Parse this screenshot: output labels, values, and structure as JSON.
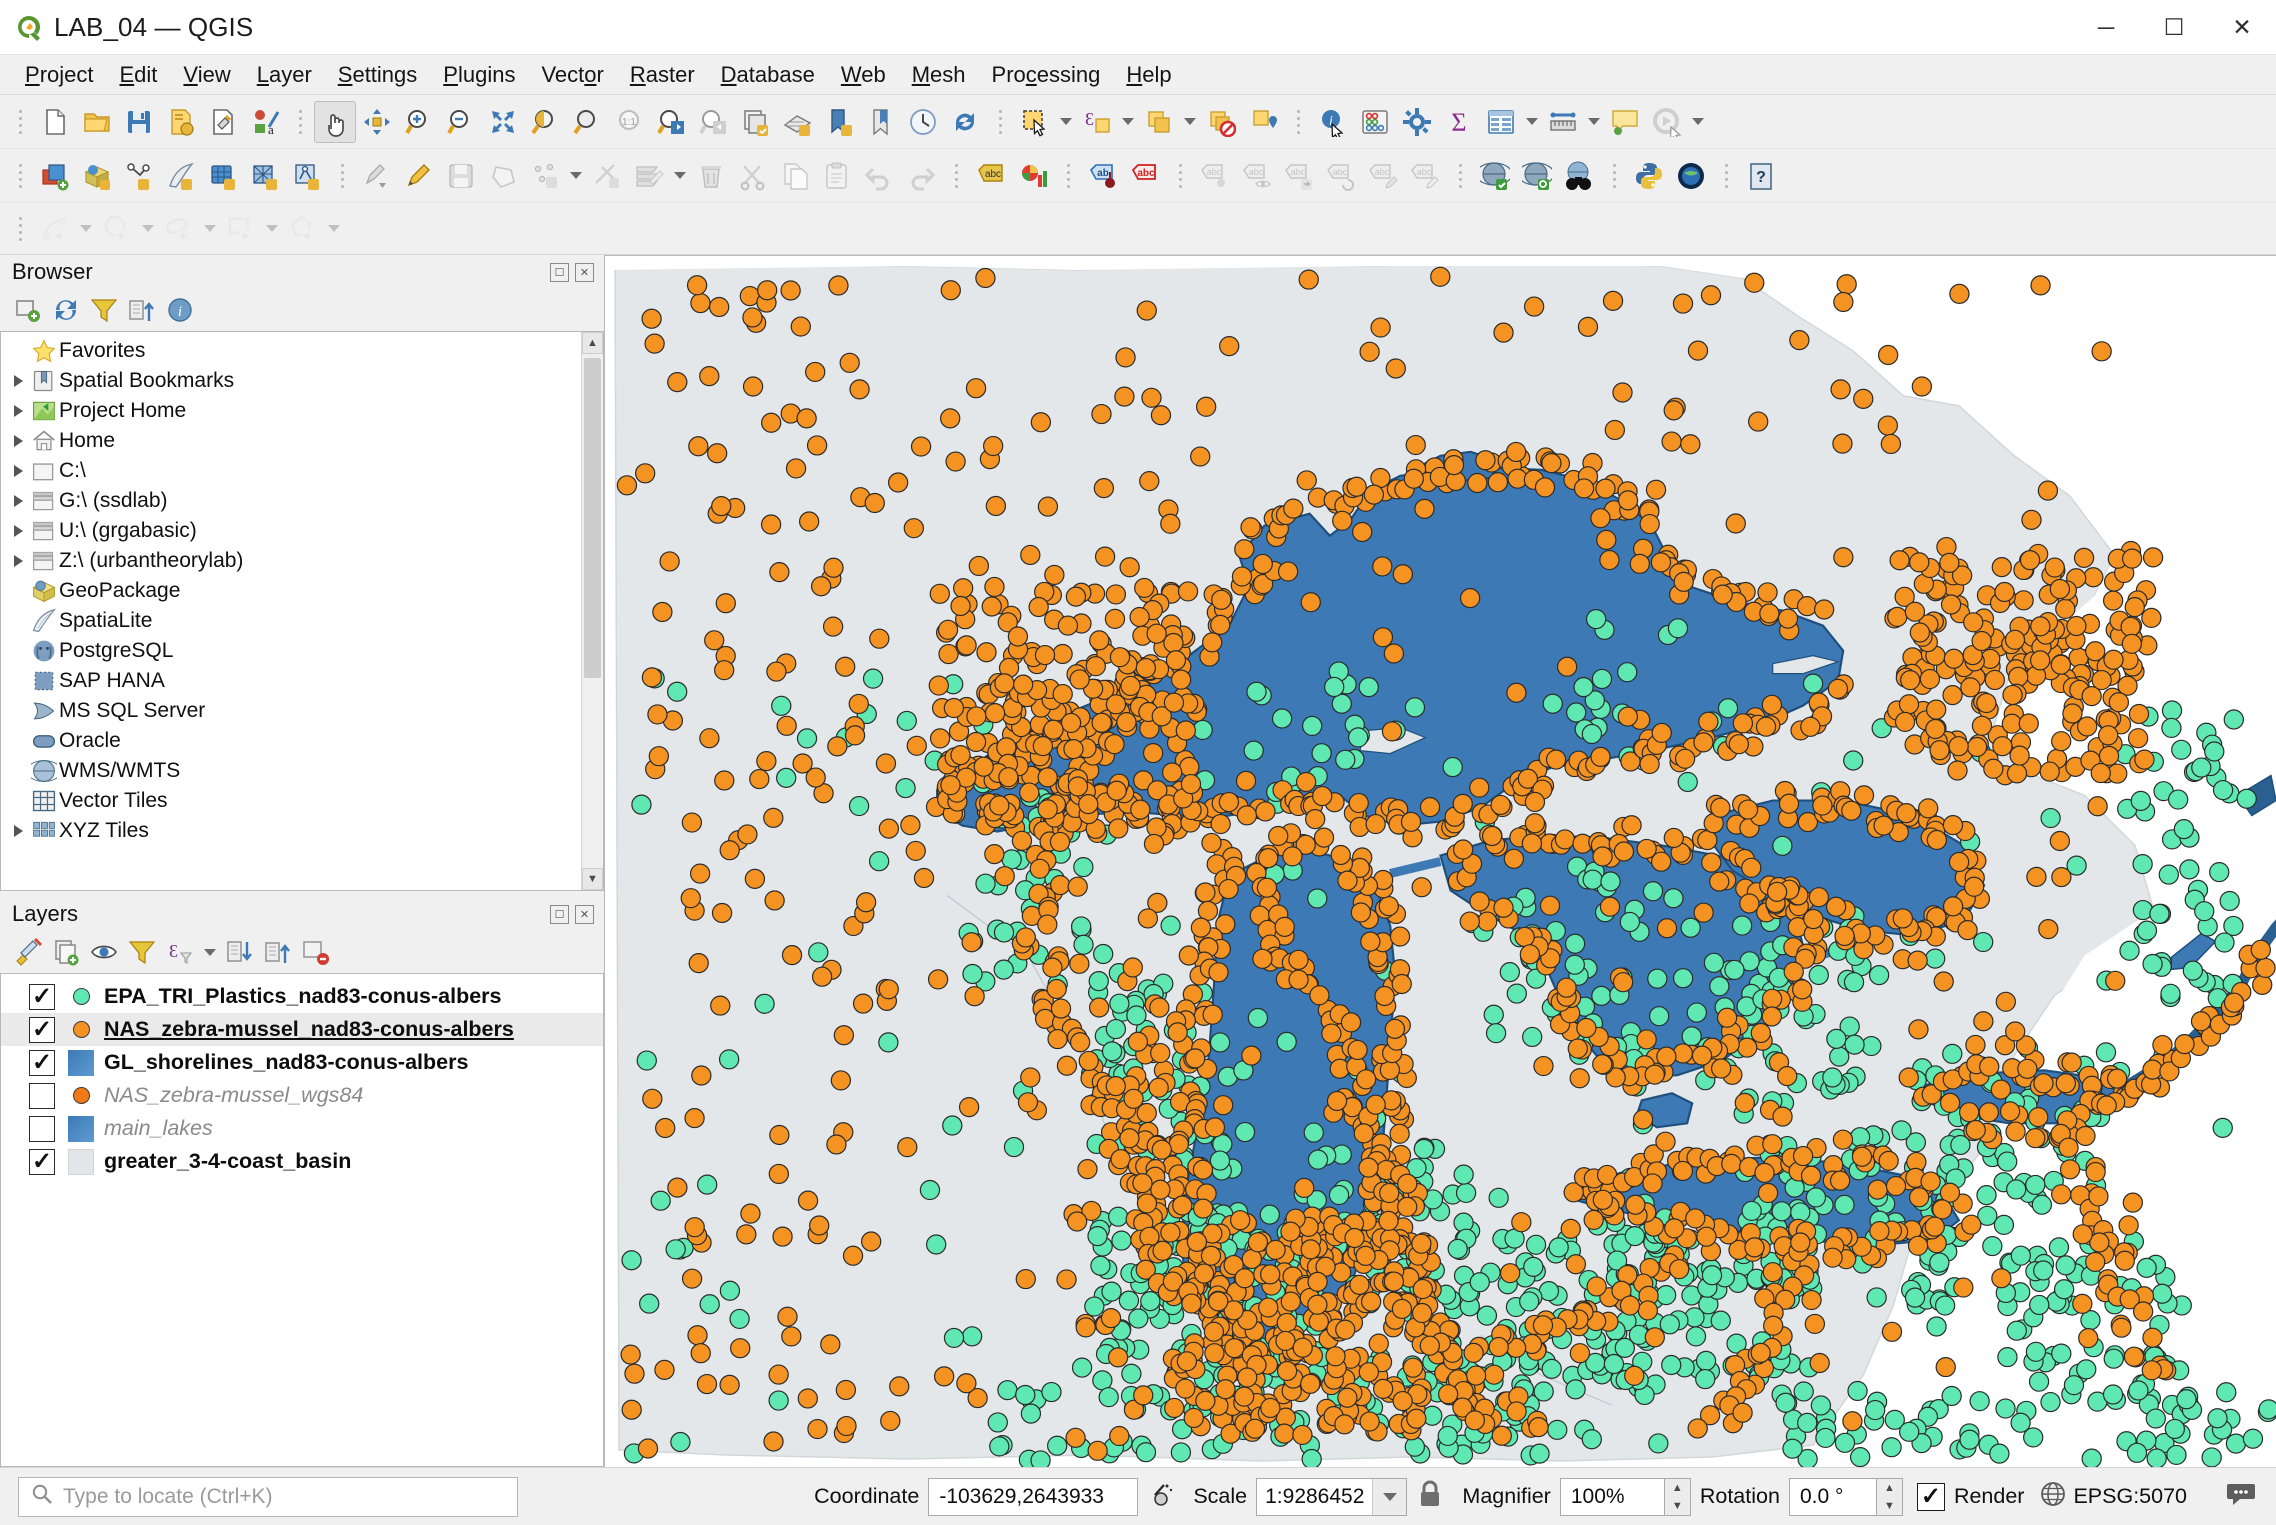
{
  "window": {
    "title": "LAB_04 — QGIS",
    "logo_icon": "qgis-logo-icon",
    "minimize_label": "─",
    "maximize_label": "☐",
    "close_label": "✕"
  },
  "menubar": {
    "items": [
      {
        "label": "Project",
        "accel": "P"
      },
      {
        "label": "Edit",
        "accel": "E"
      },
      {
        "label": "View",
        "accel": "V"
      },
      {
        "label": "Layer",
        "accel": "L"
      },
      {
        "label": "Settings",
        "accel": "S"
      },
      {
        "label": "Plugins",
        "accel": "P"
      },
      {
        "label": "Vector",
        "accel": "o"
      },
      {
        "label": "Raster",
        "accel": "R"
      },
      {
        "label": "Database",
        "accel": "D"
      },
      {
        "label": "Web",
        "accel": "W"
      },
      {
        "label": "Mesh",
        "accel": "M"
      },
      {
        "label": "Processing",
        "accel": "c"
      },
      {
        "label": "Help",
        "accel": "H"
      }
    ]
  },
  "toolbars": {
    "row1": [
      {
        "name": "new-project-icon",
        "group": 0
      },
      {
        "name": "open-project-icon",
        "group": 0
      },
      {
        "name": "save-project-icon",
        "group": 0
      },
      {
        "name": "save-project-as-icon",
        "group": 0
      },
      {
        "name": "new-print-layout-icon",
        "group": 0
      },
      {
        "name": "style-manager-icon",
        "group": 0
      },
      {
        "name": "pan-map-icon",
        "group": 1
      },
      {
        "name": "pan-to-selection-icon",
        "group": 1
      },
      {
        "name": "zoom-in-icon",
        "group": 1
      },
      {
        "name": "zoom-out-icon",
        "group": 1
      },
      {
        "name": "zoom-full-icon",
        "group": 1
      },
      {
        "name": "zoom-to-selection-icon",
        "group": 1
      },
      {
        "name": "zoom-to-layer-icon",
        "group": 1
      },
      {
        "name": "zoom-native-icon",
        "group": 1
      },
      {
        "name": "zoom-last-icon",
        "group": 1
      },
      {
        "name": "zoom-next-icon",
        "group": 1
      },
      {
        "name": "new-map-view-icon",
        "group": 1
      },
      {
        "name": "new-3d-map-view-icon",
        "group": 1
      },
      {
        "name": "show-bookmarks-icon",
        "group": 1
      },
      {
        "name": "new-bookmark-icon",
        "group": 1
      },
      {
        "name": "temporal-controller-icon",
        "group": 1
      },
      {
        "name": "refresh-map-icon",
        "group": 1
      },
      {
        "name": "select-features-icon",
        "group": 2
      },
      {
        "name": "select-by-expression-icon",
        "group": 2
      },
      {
        "name": "select-by-value-icon",
        "group": 2
      },
      {
        "name": "deselect-features-icon",
        "group": 2
      },
      {
        "name": "select-location-icon",
        "group": 2
      },
      {
        "name": "identify-features-icon",
        "group": 3
      },
      {
        "name": "statistical-summary-icon",
        "group": 3
      },
      {
        "name": "processing-toolbox-icon",
        "group": 3
      },
      {
        "name": "field-calculator-icon",
        "group": 3
      },
      {
        "name": "open-attribute-table-icon",
        "group": 3
      },
      {
        "name": "measure-line-icon",
        "group": 3
      },
      {
        "name": "map-tips-icon",
        "group": 3
      },
      {
        "name": "run-model-icon",
        "group": 3
      }
    ],
    "row2": [
      {
        "name": "open-data-source-manager-icon",
        "group": 0
      },
      {
        "name": "add-geopackage-layer-icon",
        "group": 0
      },
      {
        "name": "add-vector-layer-icon",
        "group": 0
      },
      {
        "name": "add-spatialite-layer-icon",
        "group": 0
      },
      {
        "name": "add-raster-layer-icon",
        "group": 0
      },
      {
        "name": "add-mesh-layer-icon",
        "group": 0
      },
      {
        "name": "add-delimited-text-layer-icon",
        "group": 0
      },
      {
        "name": "current-edits-icon",
        "group": 1
      },
      {
        "name": "toggle-editing-icon",
        "group": 1
      },
      {
        "name": "save-layer-edits-icon",
        "group": 1
      },
      {
        "name": "add-polygon-feature-icon",
        "group": 1
      },
      {
        "name": "vertex-tool-icon",
        "group": 1
      },
      {
        "name": "modify-attributes-icon",
        "group": 1
      },
      {
        "name": "multi-edit-icon",
        "group": 1
      },
      {
        "name": "delete-selected-icon",
        "group": 1
      },
      {
        "name": "cut-features-icon",
        "group": 1
      },
      {
        "name": "copy-features-icon",
        "group": 1
      },
      {
        "name": "paste-features-icon",
        "group": 1
      },
      {
        "name": "undo-icon",
        "group": 1
      },
      {
        "name": "redo-icon",
        "group": 1
      },
      {
        "name": "label-toolbar-icon",
        "group": 2
      },
      {
        "name": "diagram-toolbar-icon",
        "group": 2
      },
      {
        "name": "pin-labels-icon",
        "group": 3
      },
      {
        "name": "highlight-labels-icon",
        "group": 3
      },
      {
        "name": "move-label-icon",
        "group": 4
      },
      {
        "name": "show-hide-label-icon",
        "group": 4
      },
      {
        "name": "change-label-icon",
        "group": 4
      },
      {
        "name": "rotate-label-icon",
        "group": 4
      },
      {
        "name": "change-label-properties-icon",
        "group": 4
      },
      {
        "name": "edit-label-icon",
        "group": 4
      },
      {
        "name": "metasearch-icon",
        "group": 5
      },
      {
        "name": "search-catalog-icon",
        "group": 5
      },
      {
        "name": "binoculars-icon",
        "group": 5
      },
      {
        "name": "python-console-icon",
        "group": 6
      },
      {
        "name": "plugin-manager-icon",
        "group": 6
      },
      {
        "name": "help-icon",
        "group": 7
      }
    ],
    "row3": [
      {
        "name": "add-circular-string-icon"
      },
      {
        "name": "add-circle-icon"
      },
      {
        "name": "add-ellipse-icon"
      },
      {
        "name": "add-rectangle-icon"
      },
      {
        "name": "add-regular-polygon-icon"
      }
    ]
  },
  "browser": {
    "title": "Browser",
    "tools": [
      {
        "name": "add-layer-icon"
      },
      {
        "name": "refresh-icon"
      },
      {
        "name": "filter-browser-icon"
      },
      {
        "name": "collapse-all-icon"
      },
      {
        "name": "properties-icon"
      }
    ],
    "items": [
      {
        "label": "Favorites",
        "icon": "star-icon",
        "expandable": false
      },
      {
        "label": "Spatial Bookmarks",
        "icon": "bookmark-icon",
        "expandable": true
      },
      {
        "label": "Project Home",
        "icon": "project-home-icon",
        "expandable": true
      },
      {
        "label": "Home",
        "icon": "home-icon",
        "expandable": true
      },
      {
        "label": "C:\\",
        "icon": "folder-icon",
        "expandable": true
      },
      {
        "label": "G:\\ (ssdlab)",
        "icon": "network-drive-icon",
        "expandable": true
      },
      {
        "label": "U:\\ (grgabasic)",
        "icon": "network-drive-icon",
        "expandable": true
      },
      {
        "label": "Z:\\ (urbantheorylab)",
        "icon": "network-drive-icon",
        "expandable": true
      },
      {
        "label": "GeoPackage",
        "icon": "geopackage-icon",
        "expandable": false
      },
      {
        "label": "SpatiaLite",
        "icon": "spatialite-icon",
        "expandable": false
      },
      {
        "label": "PostgreSQL",
        "icon": "postgresql-icon",
        "expandable": false
      },
      {
        "label": "SAP HANA",
        "icon": "sap-hana-icon",
        "expandable": false
      },
      {
        "label": "MS SQL Server",
        "icon": "mssql-icon",
        "expandable": false
      },
      {
        "label": "Oracle",
        "icon": "oracle-icon",
        "expandable": false
      },
      {
        "label": "WMS/WMTS",
        "icon": "wms-icon",
        "expandable": false
      },
      {
        "label": "Vector Tiles",
        "icon": "vector-tiles-icon",
        "expandable": false
      },
      {
        "label": "XYZ Tiles",
        "icon": "xyz-tiles-icon",
        "expandable": true
      }
    ]
  },
  "layers": {
    "title": "Layers",
    "tools": [
      {
        "name": "open-layer-styling-icon"
      },
      {
        "name": "add-group-icon"
      },
      {
        "name": "manage-map-themes-icon"
      },
      {
        "name": "filter-legend-icon"
      },
      {
        "name": "filter-legend-expression-icon"
      },
      {
        "name": "expand-all-icon"
      },
      {
        "name": "collapse-all-icon"
      },
      {
        "name": "remove-layer-icon"
      }
    ],
    "items": [
      {
        "label": "EPA_TRI_Plastics_nad83-conus-albers",
        "checked": true,
        "symbol": "point",
        "color": "#5fe8b2",
        "selected": false,
        "underline": false
      },
      {
        "label": "NAS_zebra-mussel_nad83-conus-albers",
        "checked": true,
        "symbol": "point",
        "color": "#f59322",
        "selected": true,
        "underline": true
      },
      {
        "label": "GL_shorelines_nad83-conus-albers",
        "checked": true,
        "symbol": "fill",
        "color": "#3d7ab5",
        "selected": false,
        "underline": false
      },
      {
        "label": "NAS_zebra-mussel_wgs84",
        "checked": false,
        "symbol": "point",
        "color": "#f07a18",
        "selected": false,
        "underline": false
      },
      {
        "label": "main_lakes",
        "checked": false,
        "symbol": "fill",
        "color": "#3d7ab5",
        "selected": false,
        "underline": false
      },
      {
        "label": "greater_3-4-coast_basin",
        "checked": true,
        "symbol": "fill",
        "color": "#e2e6e8",
        "selected": false,
        "underline": false
      }
    ]
  },
  "map": {
    "colors": {
      "background": "#ffffff",
      "basin": "#e3e7e9",
      "lake": "#3d7ab5",
      "lake_outline": "#1f4f7d",
      "zebra_mussel_point": "#f59322",
      "plastics_point": "#5fe8b2",
      "point_outline": "#2b2b2b"
    }
  },
  "statusbar": {
    "locator_placeholder": "Type to locate (Ctrl+K)",
    "locator_icon": "search-icon",
    "coordinate_label": "Coordinate",
    "coordinate_value": "-103629,2643933",
    "coordinate_toggle_icon": "coordinate-capture-icon",
    "scale_label": "Scale",
    "scale_value": "1:9286452",
    "scale_lock_icon": "lock-icon",
    "magnifier_label": "Magnifier",
    "magnifier_value": "100%",
    "rotation_label": "Rotation",
    "rotation_value": "0.0 °",
    "render_label": "Render",
    "render_checked": true,
    "crs_icon": "globe-icon",
    "crs_value": "EPSG:5070",
    "messages_icon": "messages-icon"
  }
}
